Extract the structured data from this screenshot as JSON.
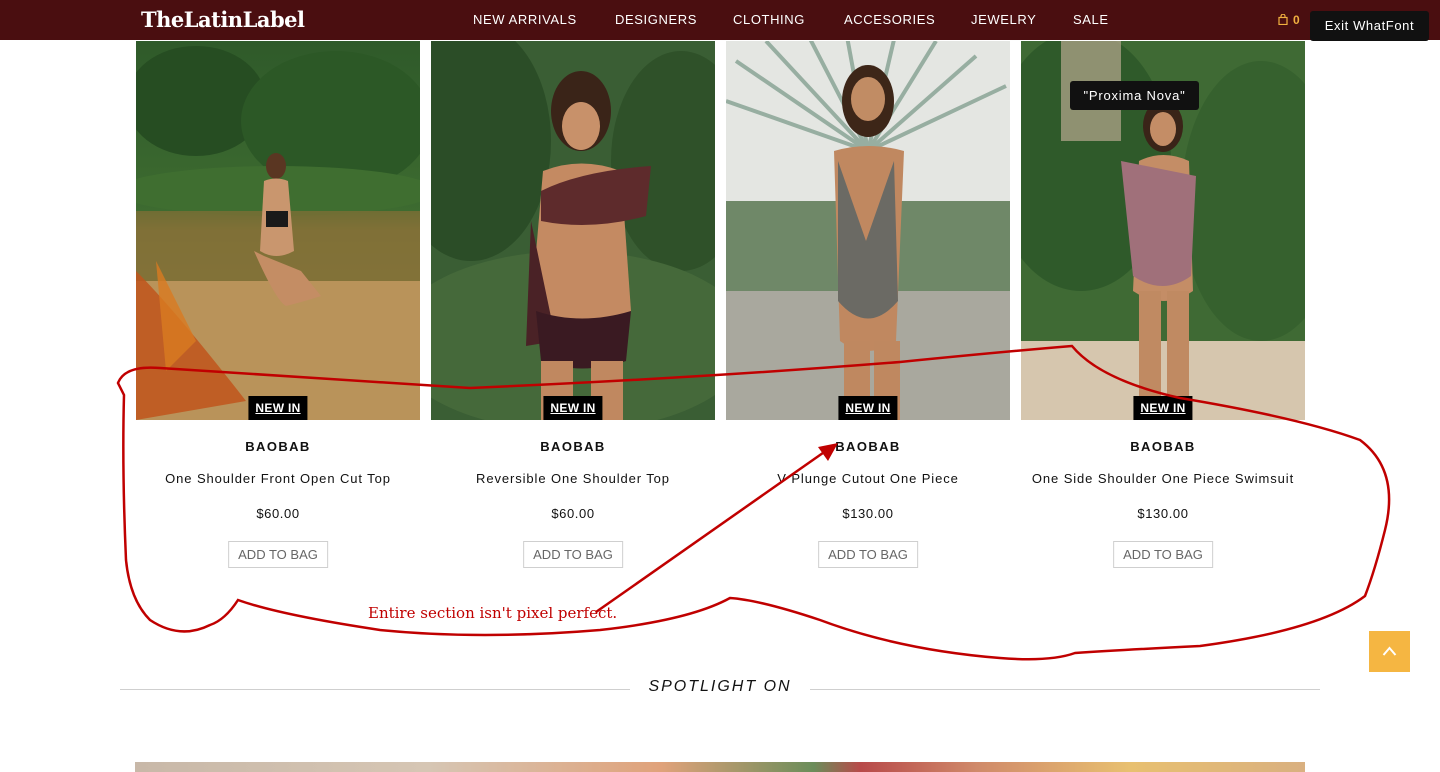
{
  "header": {
    "logo": "TheLatinLabel",
    "nav": [
      "NEW ARRIVALS",
      "DESIGNERS",
      "CLOTHING",
      "ACCESORIES",
      "JEWELRY",
      "SALE"
    ],
    "cart_count": "0",
    "exit_button": "Exit WhatFont"
  },
  "font_tooltip": "\"Proxima Nova\"",
  "products": [
    {
      "badge": "NEW IN",
      "brand": "BAOBAB",
      "name": "One Shoulder Front Open Cut Top",
      "price": "$60.00",
      "button": "ADD TO BAG"
    },
    {
      "badge": "NEW IN",
      "brand": "BAOBAB",
      "name": "Reversible One Shoulder Top",
      "price": "$60.00",
      "button": "ADD TO BAG"
    },
    {
      "badge": "NEW IN",
      "brand": "BAOBAB",
      "name": "V Plunge Cutout One Piece",
      "price": "$130.00",
      "button": "ADD TO BAG"
    },
    {
      "badge": "NEW IN",
      "brand": "BAOBAB",
      "name": "One Side Shoulder One Piece Swimsuit",
      "price": "$130.00",
      "button": "ADD TO BAG"
    }
  ],
  "annotation": {
    "text": "Entire section isn't pixel perfect.",
    "color": "#c00000"
  },
  "spotlight": {
    "title": "SPOTLIGHT ON"
  },
  "colors": {
    "header_bg": "#4a0e10",
    "accent": "#f5b642"
  },
  "icons": {
    "cart": "shopping-bag-icon",
    "scroll_top": "chevron-up-icon"
  }
}
